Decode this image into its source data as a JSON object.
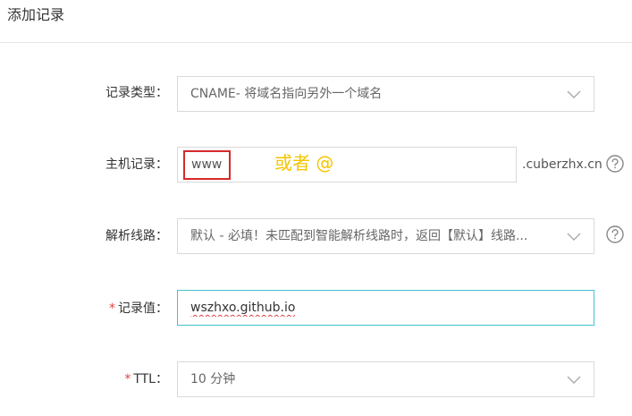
{
  "header": {
    "title": "添加记录"
  },
  "form": {
    "record_type": {
      "label": "记录类型：",
      "value": "CNAME- 将域名指向另外一个域名"
    },
    "host": {
      "label": "主机记录：",
      "value": "www",
      "suffix": ".cuberzhx.cn",
      "annotation": "或者 @"
    },
    "line": {
      "label": "解析线路：",
      "value": "默认 - 必填！未匹配到智能解析线路时，返回【默认】线路..."
    },
    "value": {
      "required": "*",
      "label": "记录值：",
      "value": "wszhxo.github.io"
    },
    "ttl": {
      "required": "*",
      "label": "TTL：",
      "value": "10 分钟"
    }
  },
  "icons": {
    "chevron": "chevron-down-icon",
    "help": "question-circle-icon"
  },
  "colors": {
    "required": "#e24141",
    "focus_border": "#3ec4cf",
    "annotation_box": "#d52a2a",
    "annotation_text": "#f5c400"
  }
}
